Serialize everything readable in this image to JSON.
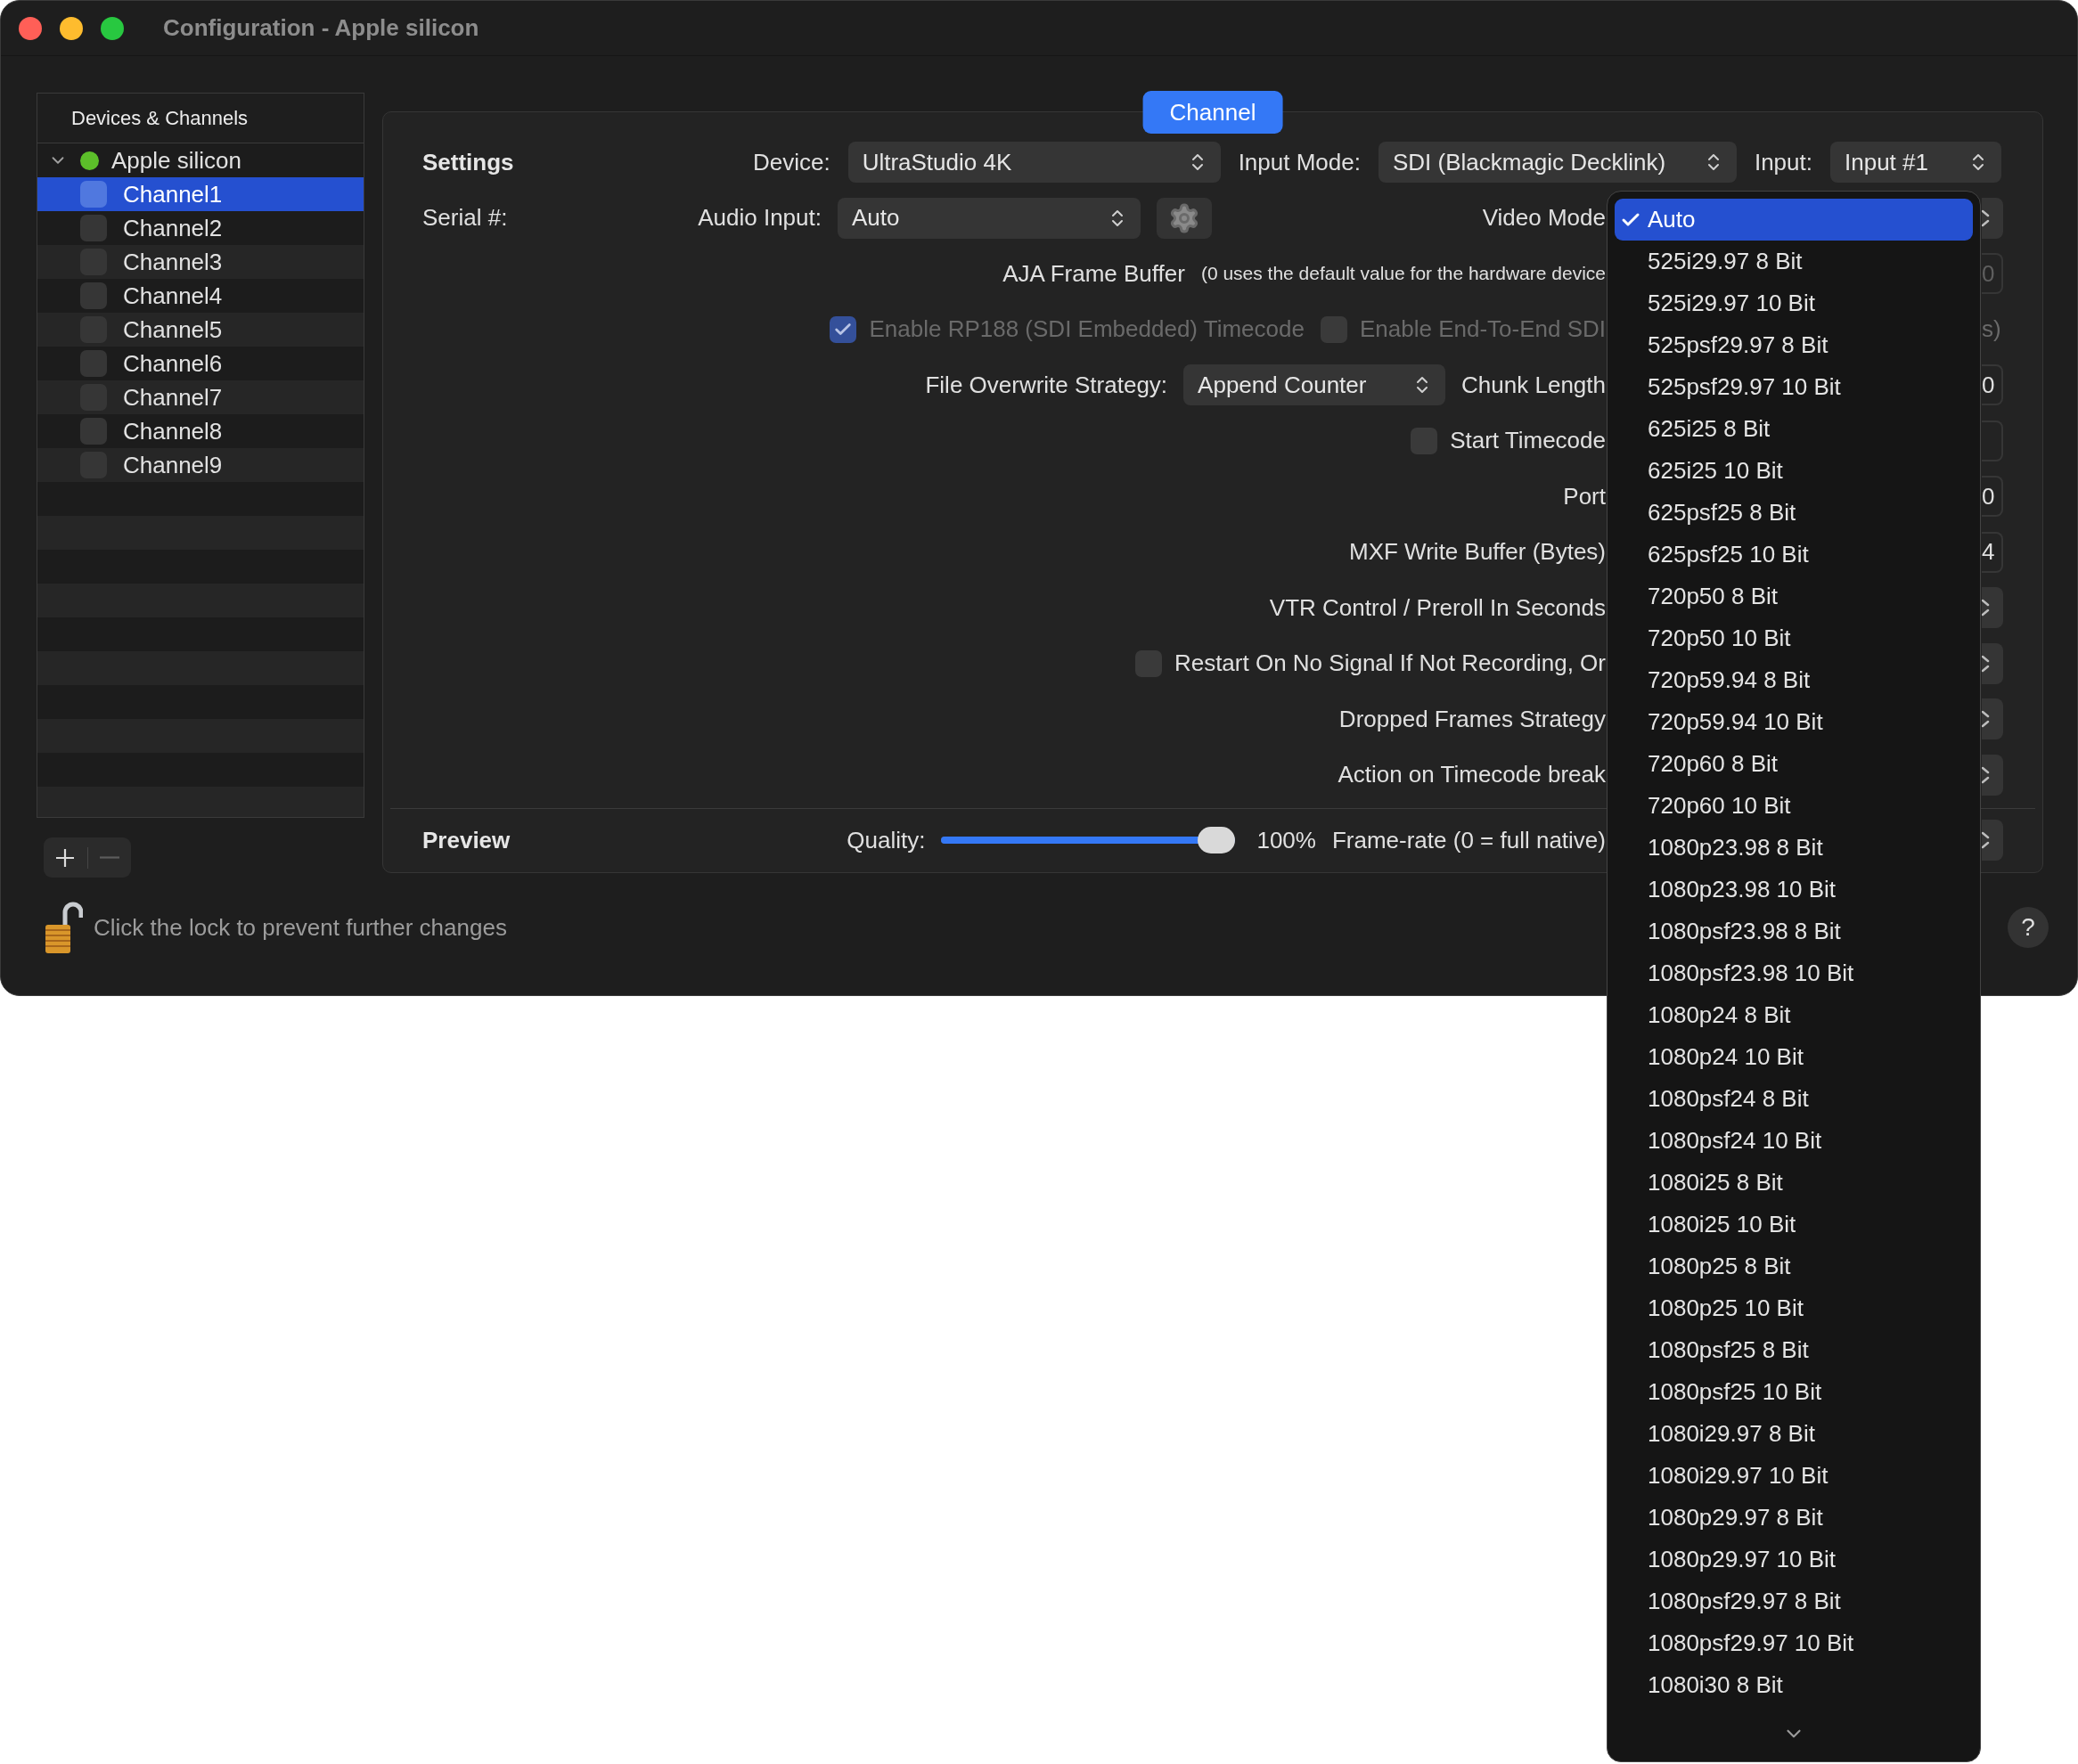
{
  "window": {
    "title": "Configuration - Apple silicon"
  },
  "sidebar": {
    "header": "Devices & Channels",
    "device": {
      "name": "Apple silicon",
      "expanded": true,
      "color": "#5cbf2a"
    },
    "channels": [
      {
        "name": "Channel1",
        "selected": true,
        "checked": false
      },
      {
        "name": "Channel2",
        "selected": false,
        "checked": false
      },
      {
        "name": "Channel3",
        "selected": false,
        "checked": false
      },
      {
        "name": "Channel4",
        "selected": false,
        "checked": false
      },
      {
        "name": "Channel5",
        "selected": false,
        "checked": false
      },
      {
        "name": "Channel6",
        "selected": false,
        "checked": false
      },
      {
        "name": "Channel7",
        "selected": false,
        "checked": false
      },
      {
        "name": "Channel8",
        "selected": false,
        "checked": false
      },
      {
        "name": "Channel9",
        "selected": false,
        "checked": false
      }
    ],
    "buttons": [
      {
        "kind": "add",
        "disabled": false
      },
      {
        "kind": "remove",
        "disabled": true
      }
    ]
  },
  "tab": {
    "label": "Channel",
    "selected": true
  },
  "settings": {
    "title": "Settings",
    "device": {
      "label": "Device:",
      "value": "UltraStudio 4K"
    },
    "input_mode": {
      "label": "Input Mode:",
      "value": "SDI (Blackmagic Decklink)"
    },
    "input": {
      "label": "Input:",
      "value": "Input #1"
    },
    "serial": {
      "label": "Serial #:"
    },
    "audio_input": {
      "label": "Audio Input:",
      "value": "Auto"
    },
    "video_mode": {
      "label": "Video Mode",
      "edge": {
        "kind": "popup"
      }
    },
    "rows": [
      {
        "items": [
          {
            "kind": "label",
            "text": "AJA Frame Buffer"
          },
          {
            "kind": "note",
            "text": "(0 uses the default value for the hardware device"
          }
        ],
        "edge": {
          "kind": "field",
          "value": "0",
          "disabled": true
        }
      },
      {
        "items": [
          {
            "kind": "checkbox",
            "text": "Enable RP188 (SDI Embedded) Timecode",
            "checked": true,
            "disabled": true
          },
          {
            "kind": "checkbox",
            "text": "Enable End-To-End SDI",
            "checked": false,
            "disabled": true
          }
        ],
        "edge": {
          "kind": "text",
          "value": "s)",
          "disabled": true
        }
      },
      {
        "items": [
          {
            "kind": "label",
            "text": "File Overwrite Strategy:"
          },
          {
            "kind": "popup",
            "text": "Append Counter"
          },
          {
            "kind": "label",
            "text": "Chunk Length"
          }
        ],
        "edge": {
          "kind": "field",
          "value": "0"
        }
      },
      {
        "items": [
          {
            "kind": "checkbox",
            "text": "Start Timecode",
            "checked": false,
            "disabled": false
          }
        ],
        "edge": {
          "kind": "field"
        }
      },
      {
        "items": [
          {
            "kind": "label",
            "text": "Port"
          }
        ],
        "edge": {
          "kind": "field",
          "value": "0"
        }
      },
      {
        "items": [
          {
            "kind": "label",
            "text": "MXF Write Buffer (Bytes)"
          }
        ],
        "edge": {
          "kind": "field",
          "value": "4"
        }
      },
      {
        "items": [
          {
            "kind": "label",
            "text": "VTR Control / Preroll In Seconds"
          }
        ],
        "edge": {
          "kind": "popup"
        }
      },
      {
        "items": [
          {
            "kind": "checkbox",
            "text": "Restart On No Signal If Not Recording, Or",
            "checked": false,
            "disabled": false
          }
        ],
        "edge": {
          "kind": "popup"
        }
      },
      {
        "items": [
          {
            "kind": "label",
            "text": "Dropped Frames Strategy"
          }
        ],
        "edge": {
          "kind": "popup"
        }
      },
      {
        "items": [
          {
            "kind": "label",
            "text": "Action on Timecode break"
          }
        ],
        "edge": {
          "kind": "popup"
        }
      }
    ]
  },
  "preview": {
    "title": "Preview",
    "quality_label": "Quality:",
    "level": 1,
    "reading": "100%",
    "framerate_label": "Frame-rate (0 = full native)",
    "edge": {
      "kind": "popup"
    }
  },
  "video_mode_menu": {
    "items": [
      {
        "label": "Auto",
        "selected": true
      },
      {
        "label": "525i29.97 8 Bit",
        "selected": false
      },
      {
        "label": "525i29.97 10 Bit",
        "selected": false
      },
      {
        "label": "525psf29.97 8 Bit",
        "selected": false
      },
      {
        "label": "525psf29.97 10 Bit",
        "selected": false
      },
      {
        "label": "625i25 8 Bit",
        "selected": false
      },
      {
        "label": "625i25 10 Bit",
        "selected": false
      },
      {
        "label": "625psf25 8 Bit",
        "selected": false
      },
      {
        "label": "625psf25 10 Bit",
        "selected": false
      },
      {
        "label": "720p50 8 Bit",
        "selected": false
      },
      {
        "label": "720p50 10 Bit",
        "selected": false
      },
      {
        "label": "720p59.94 8 Bit",
        "selected": false
      },
      {
        "label": "720p59.94 10 Bit",
        "selected": false
      },
      {
        "label": "720p60 8 Bit",
        "selected": false
      },
      {
        "label": "720p60 10 Bit",
        "selected": false
      },
      {
        "label": "1080p23.98 8 Bit",
        "selected": false
      },
      {
        "label": "1080p23.98 10 Bit",
        "selected": false
      },
      {
        "label": "1080psf23.98 8 Bit",
        "selected": false
      },
      {
        "label": "1080psf23.98 10 Bit",
        "selected": false
      },
      {
        "label": "1080p24 8 Bit",
        "selected": false
      },
      {
        "label": "1080p24 10 Bit",
        "selected": false
      },
      {
        "label": "1080psf24 8 Bit",
        "selected": false
      },
      {
        "label": "1080psf24 10 Bit",
        "selected": false
      },
      {
        "label": "1080i25 8 Bit",
        "selected": false
      },
      {
        "label": "1080i25 10 Bit",
        "selected": false
      },
      {
        "label": "1080p25 8 Bit",
        "selected": false
      },
      {
        "label": "1080p25 10 Bit",
        "selected": false
      },
      {
        "label": "1080psf25 8 Bit",
        "selected": false
      },
      {
        "label": "1080psf25 10 Bit",
        "selected": false
      },
      {
        "label": "1080i29.97 8 Bit",
        "selected": false
      },
      {
        "label": "1080i29.97 10 Bit",
        "selected": false
      },
      {
        "label": "1080p29.97 8 Bit",
        "selected": false
      },
      {
        "label": "1080p29.97 10 Bit",
        "selected": false
      },
      {
        "label": "1080psf29.97 8 Bit",
        "selected": false
      },
      {
        "label": "1080psf29.97 10 Bit",
        "selected": false
      },
      {
        "label": "1080i30 8 Bit",
        "selected": false
      }
    ]
  },
  "footer": {
    "lock_text": "Click the lock to prevent further changes",
    "help": "?"
  }
}
